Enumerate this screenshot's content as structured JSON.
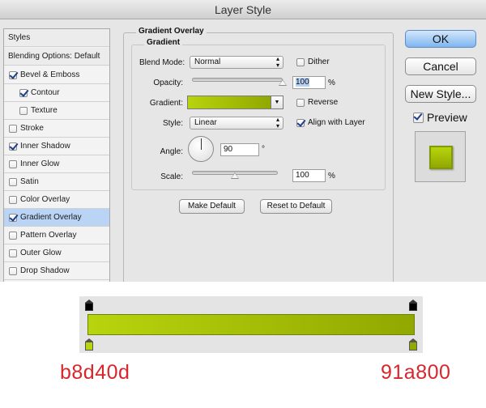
{
  "window": {
    "title": "Layer Style"
  },
  "styles_panel": {
    "header": "Styles",
    "blending": "Blending Options: Default",
    "items": [
      {
        "label": "Bevel & Emboss",
        "checked": true,
        "indent": false,
        "selected": false
      },
      {
        "label": "Contour",
        "checked": true,
        "indent": true,
        "selected": false
      },
      {
        "label": "Texture",
        "checked": false,
        "indent": true,
        "selected": false
      },
      {
        "label": "Stroke",
        "checked": false,
        "indent": false,
        "selected": false
      },
      {
        "label": "Inner Shadow",
        "checked": true,
        "indent": false,
        "selected": false
      },
      {
        "label": "Inner Glow",
        "checked": false,
        "indent": false,
        "selected": false
      },
      {
        "label": "Satin",
        "checked": false,
        "indent": false,
        "selected": false
      },
      {
        "label": "Color Overlay",
        "checked": false,
        "indent": false,
        "selected": false
      },
      {
        "label": "Gradient Overlay",
        "checked": true,
        "indent": false,
        "selected": true
      },
      {
        "label": "Pattern Overlay",
        "checked": false,
        "indent": false,
        "selected": false
      },
      {
        "label": "Outer Glow",
        "checked": false,
        "indent": false,
        "selected": false
      },
      {
        "label": "Drop Shadow",
        "checked": false,
        "indent": false,
        "selected": false
      }
    ]
  },
  "gradient_overlay": {
    "group_title": "Gradient Overlay",
    "sub_title": "Gradient",
    "blend_mode": {
      "label": "Blend Mode:",
      "value": "Normal"
    },
    "dither": {
      "label": "Dither",
      "checked": false
    },
    "opacity": {
      "label": "Opacity:",
      "value": "100",
      "unit": "%",
      "level": 1.0
    },
    "gradient": {
      "label": "Gradient:"
    },
    "reverse": {
      "label": "Reverse",
      "checked": false
    },
    "style": {
      "label": "Style:",
      "value": "Linear"
    },
    "align": {
      "label": "Align with Layer",
      "checked": true
    },
    "angle": {
      "label": "Angle:",
      "value": "90",
      "unit": "°"
    },
    "scale": {
      "label": "Scale:",
      "value": "100",
      "unit": "%",
      "level": 0.5
    },
    "make_default": "Make Default",
    "reset_default": "Reset to Default"
  },
  "buttons": {
    "ok": "OK",
    "cancel": "Cancel",
    "new_style": "New Style..."
  },
  "preview": {
    "label": "Preview",
    "checked": true
  },
  "gradient_strip": {
    "start_color": "b8d40d",
    "end_color": "91a800"
  },
  "colors": {
    "gradient_start": "#b8d40d",
    "gradient_end": "#91a800",
    "accent": "#d8262c"
  },
  "icons": {
    "dropdown": "up-down-arrows-icon",
    "checkbox": "checkmark-icon",
    "angle": "angle-dial-icon",
    "stop": "color-stop-icon"
  }
}
